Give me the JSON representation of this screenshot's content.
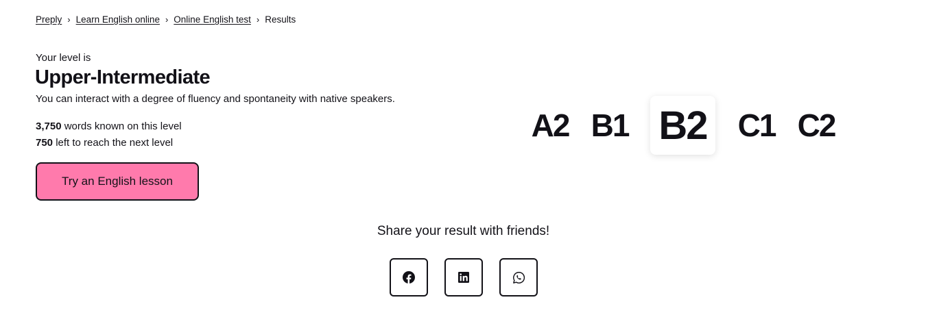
{
  "breadcrumb": {
    "items": [
      "Preply",
      "Learn English online",
      "Online English test"
    ],
    "separator": "›",
    "current": "Results"
  },
  "result": {
    "intro": "Your level is",
    "level_name": "Upper-Intermediate",
    "description": "You can interact with a degree of fluency and spontaneity with native speakers.",
    "words_known_value": "3,750",
    "words_known_text": " words known on this level",
    "left_value": "750",
    "left_text": " left to reach the next level",
    "cta_label": "Try an English lesson"
  },
  "scale": {
    "levels": [
      "A2",
      "B1",
      "B2",
      "C1",
      "C2"
    ],
    "current": "B2"
  },
  "share": {
    "title": "Share your result with friends!",
    "buttons": [
      "facebook-icon",
      "linkedin-icon",
      "whatsapp-icon"
    ]
  },
  "colors": {
    "accent": "#ff7aac",
    "text": "#121117",
    "background": "#ffffff"
  }
}
